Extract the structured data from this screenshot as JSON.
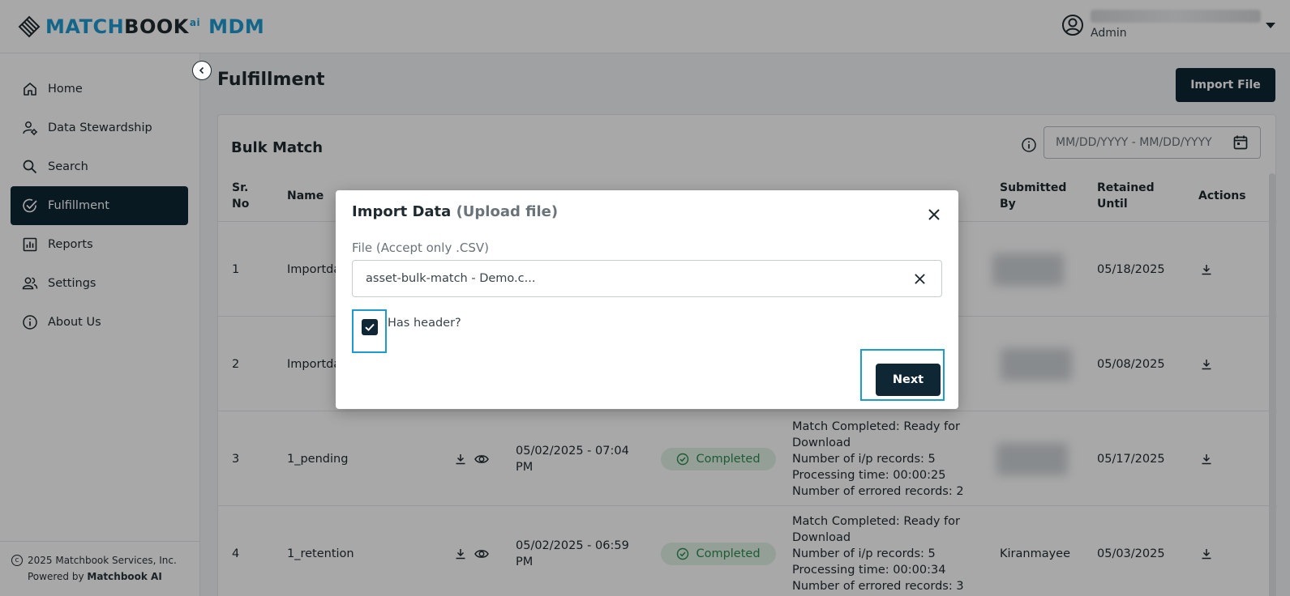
{
  "header": {
    "logo": {
      "match": "MATCH",
      "book": "BOOK",
      "ai": "ai",
      "mdm": "MDM"
    },
    "user_role": "Admin"
  },
  "sidebar": {
    "items": [
      {
        "label": "Home",
        "icon": "home-icon",
        "active": false
      },
      {
        "label": "Data Stewardship",
        "icon": "data-stewardship-icon",
        "active": false
      },
      {
        "label": "Search",
        "icon": "search-icon",
        "active": false
      },
      {
        "label": "Fulfillment",
        "icon": "fulfillment-check-icon",
        "active": true
      },
      {
        "label": "Reports",
        "icon": "reports-icon",
        "active": false
      },
      {
        "label": "Settings",
        "icon": "settings-users-icon",
        "active": false
      },
      {
        "label": "About Us",
        "icon": "info-icon",
        "active": false
      }
    ],
    "footer": {
      "copyright": "2025 Matchbook Services, Inc.",
      "powered_prefix": "Powered by",
      "powered_brand": "Matchbook AI"
    }
  },
  "page": {
    "title": "Fulfillment",
    "import_button": "Import File"
  },
  "bulk_match": {
    "title": "Bulk Match",
    "date_placeholder": "MM/DD/YYYY - MM/DD/YYYY",
    "columns": {
      "sr_no": [
        "Sr.",
        "No"
      ],
      "name": "Name",
      "submitted_by": [
        "Submitted",
        "By"
      ],
      "retained_until": [
        "Retained",
        "Until"
      ],
      "actions": "Actions"
    },
    "rows": [
      {
        "sr": "1",
        "name": "Importda",
        "retained": "05/18/2025",
        "submitted_by": ""
      },
      {
        "sr": "2",
        "name": "Importda",
        "retained": "05/08/2025",
        "submitted_by": ""
      },
      {
        "sr": "3",
        "name": "1_pending",
        "date": "05/02/2025 - 07:04 PM",
        "date_l1": "05/02/2025 - 07:04",
        "date_l2": "PM",
        "status": "Completed",
        "details": [
          "Match Completed: Ready for",
          "Download",
          "Number of i/p records: 5",
          "Processing time: 00:00:25",
          "Number of errored records: 2"
        ],
        "submitted_by": "",
        "retained": "05/17/2025"
      },
      {
        "sr": "4",
        "name": "1_retention",
        "date_l1": "05/02/2025 - 06:59",
        "date_l2": "PM",
        "status": "Completed",
        "details": [
          "Match Completed: Ready for",
          "Download",
          "Number of i/p records: 5",
          "Processing time: 00:00:34",
          "Number of errored records: 3"
        ],
        "submitted_by": "Kiranmayee",
        "retained": "05/03/2025"
      }
    ]
  },
  "modal": {
    "title": "Import Data",
    "subtitle": "(Upload file)",
    "file_label": "File (Accept only .CSV)",
    "file_value": "asset-bulk-match - Demo.c...",
    "has_header_label": "Has header?",
    "has_header_checked": true,
    "next_button": "Next"
  },
  "colors": {
    "primary_dark": "#0f2635",
    "brand_blue": "#1d9bd1",
    "success_bg": "#dff2e5",
    "success_text": "#2e8b4f",
    "highlight_outline": "#1d9bd1"
  }
}
